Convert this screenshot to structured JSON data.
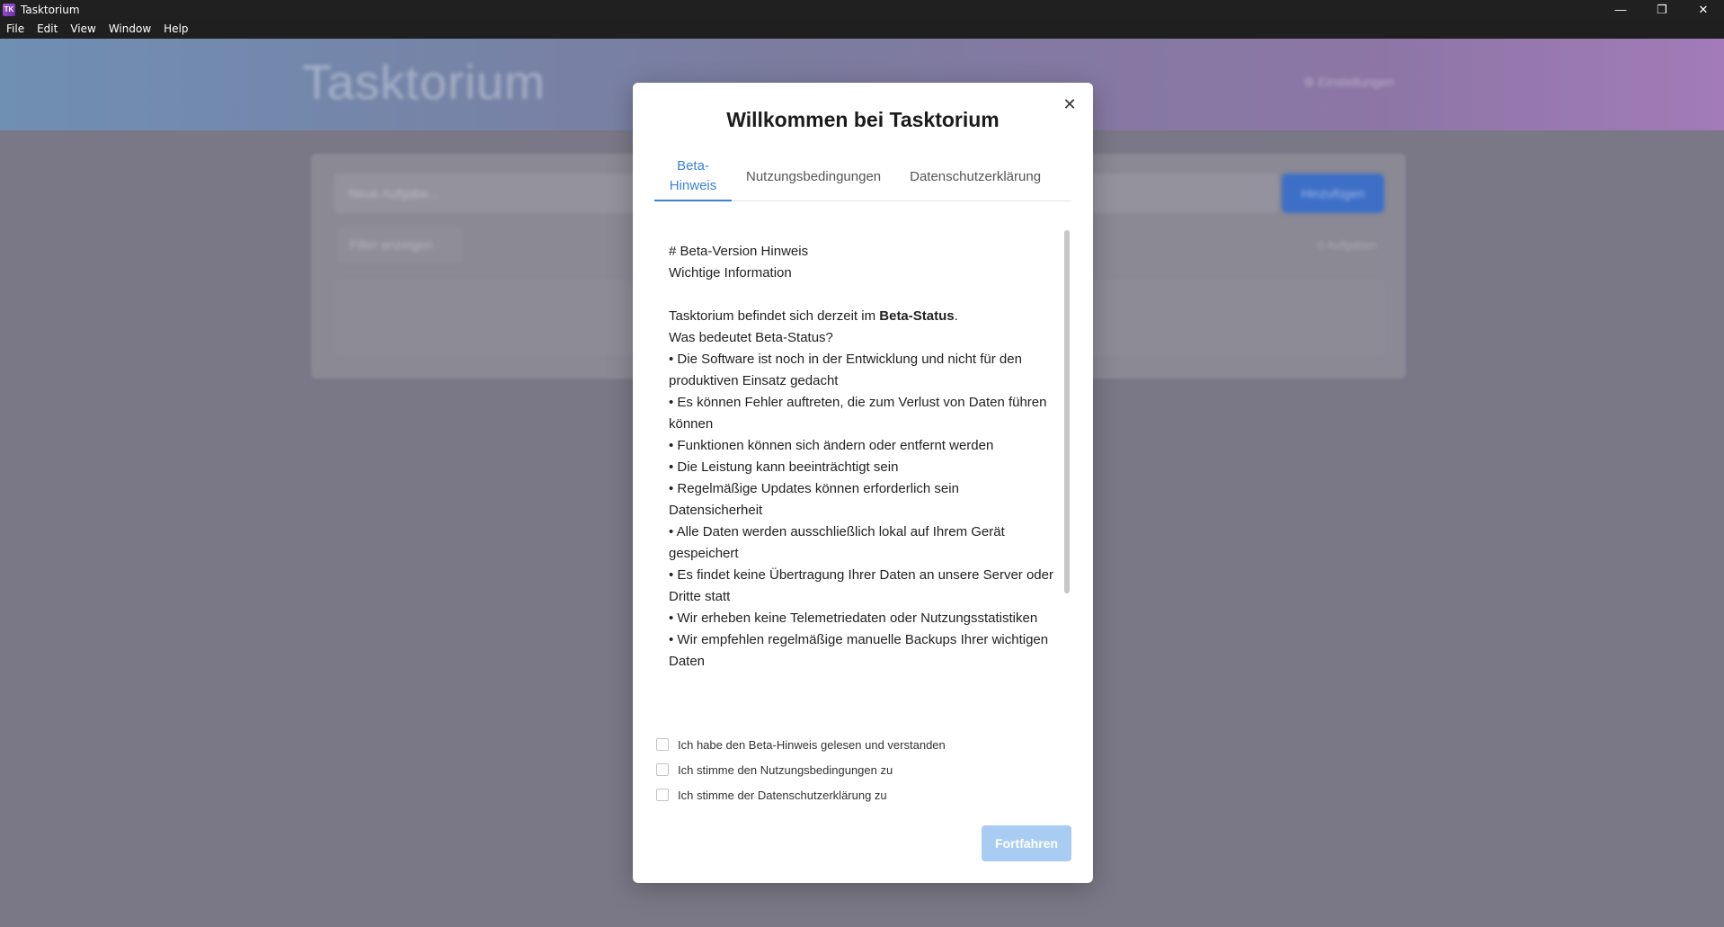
{
  "window": {
    "icon_text": "TK",
    "title": "Tasktorium",
    "controls": {
      "minimize": "—",
      "maximize": "❐",
      "close": "✕"
    }
  },
  "menubar": [
    "File",
    "Edit",
    "View",
    "Window",
    "Help"
  ],
  "background_app": {
    "logo": "Tasktorium",
    "settings": "⚙ Einstellungen",
    "input_placeholder": "Neue Aufgabe...",
    "add_button": "Hinzufügen",
    "filter_button": "Filter anzeigen",
    "count": "0 Aufgaben"
  },
  "modal": {
    "title": "Willkommen bei Tasktorium",
    "close": "✕",
    "tabs": [
      {
        "line1": "Beta-",
        "line2": "Hinweis"
      },
      {
        "label": "Nutzungsbedingungen"
      },
      {
        "label": "Datenschutzerklärung"
      }
    ],
    "content": {
      "heading": "# Beta-Version Hinweis",
      "subheading": "Wichtige Information",
      "intro_prefix": "Tasktorium befindet sich derzeit im ",
      "intro_bold": "Beta-Status",
      "intro_suffix": ".",
      "question": "Was bedeutet Beta-Status?",
      "bullets1": [
        "• Die Software ist noch in der Entwicklung und nicht für den produktiven Einsatz gedacht",
        "• Es können Fehler auftreten, die zum Verlust von Daten führen können",
        "• Funktionen können sich ändern oder entfernt werden",
        "• Die Leistung kann beeinträchtigt sein",
        "• Regelmäßige Updates können erforderlich sein"
      ],
      "section2": "Datensicherheit",
      "bullets2": [
        "• Alle Daten werden ausschließlich lokal auf Ihrem Gerät gespeichert",
        "• Es findet keine Übertragung Ihrer Daten an unsere Server oder Dritte statt",
        "• Wir erheben keine Telemetriedaten oder Nutzungsstatistiken",
        "• Wir empfehlen regelmäßige manuelle Backups Ihrer wichtigen Daten"
      ]
    },
    "checkboxes": [
      "Ich habe den Beta-Hinweis gelesen und verstanden",
      "Ich stimme den Nutzungsbedingungen zu",
      "Ich stimme der Datenschutzerklärung zu"
    ],
    "continue_button": "Fortfahren"
  }
}
